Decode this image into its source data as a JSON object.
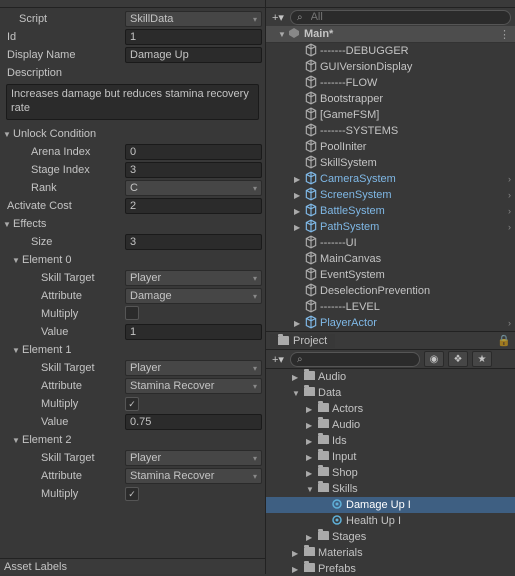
{
  "inspector": {
    "script_label": "Script",
    "script_value": "SkillData",
    "id_label": "Id",
    "id_value": "1",
    "display_name_label": "Display Name",
    "display_name_value": "Damage Up",
    "description_label": "Description",
    "description_value": "Increases damage but reduces stamina recovery rate",
    "unlock_condition": "Unlock Condition",
    "arena_index_label": "Arena Index",
    "arena_index_value": "0",
    "stage_index_label": "Stage Index",
    "stage_index_value": "3",
    "rank_label": "Rank",
    "rank_value": "C",
    "activate_cost_label": "Activate Cost",
    "activate_cost_value": "2",
    "effects": "Effects",
    "size_label": "Size",
    "size_value": "3",
    "el0": "Element 0",
    "el1": "Element 1",
    "el2": "Element 2",
    "skill_target_label": "Skill Target",
    "attribute_label": "Attribute",
    "multiply_label": "Multiply",
    "value_label": "Value",
    "e0_target": "Player",
    "e0_attr": "Damage",
    "e0_value": "1",
    "e1_target": "Player",
    "e1_attr": "Stamina Recover",
    "e1_value": "0.75",
    "e2_target": "Player",
    "e2_attr": "Stamina Recover",
    "asset_labels": "Asset Labels"
  },
  "hierarchy": {
    "search_placeholder": "All",
    "scene": "Main*",
    "items": [
      {
        "name": "-------DEBUGGER",
        "blue": false,
        "d": 1,
        "f": ""
      },
      {
        "name": "GUIVersionDisplay",
        "blue": false,
        "d": 1,
        "f": ""
      },
      {
        "name": "-------FLOW",
        "blue": false,
        "d": 1,
        "f": ""
      },
      {
        "name": "Bootstrapper",
        "blue": false,
        "d": 1,
        "f": ""
      },
      {
        "name": "[GameFSM]",
        "blue": false,
        "d": 1,
        "f": ""
      },
      {
        "name": "-------SYSTEMS",
        "blue": false,
        "d": 1,
        "f": ""
      },
      {
        "name": "PoolIniter",
        "blue": false,
        "d": 1,
        "f": ""
      },
      {
        "name": "SkillSystem",
        "blue": false,
        "d": 1,
        "f": ""
      },
      {
        "name": "CameraSystem",
        "blue": true,
        "d": 1,
        "f": "▶",
        "ch": true
      },
      {
        "name": "ScreenSystem",
        "blue": true,
        "d": 1,
        "f": "▶",
        "ch": true
      },
      {
        "name": "BattleSystem",
        "blue": true,
        "d": 1,
        "f": "▶",
        "ch": true
      },
      {
        "name": "PathSystem",
        "blue": true,
        "d": 1,
        "f": "▶",
        "ch": true
      },
      {
        "name": "-------UI",
        "blue": false,
        "d": 1,
        "f": ""
      },
      {
        "name": "MainCanvas",
        "blue": false,
        "d": 1,
        "f": ""
      },
      {
        "name": "EventSystem",
        "blue": false,
        "d": 1,
        "f": ""
      },
      {
        "name": "DeselectionPrevention",
        "blue": false,
        "d": 1,
        "f": ""
      },
      {
        "name": "-------LEVEL",
        "blue": false,
        "d": 1,
        "f": ""
      },
      {
        "name": "PlayerActor",
        "blue": true,
        "d": 1,
        "f": "▶",
        "ch": true
      }
    ]
  },
  "project": {
    "title": "Project",
    "items": [
      {
        "name": "Audio",
        "d": 2,
        "f": "▶",
        "type": "folder"
      },
      {
        "name": "Data",
        "d": 2,
        "f": "▼",
        "type": "folder"
      },
      {
        "name": "Actors",
        "d": 3,
        "f": "▶",
        "type": "folder"
      },
      {
        "name": "Audio",
        "d": 3,
        "f": "▶",
        "type": "folder"
      },
      {
        "name": "Ids",
        "d": 3,
        "f": "▶",
        "type": "folder"
      },
      {
        "name": "Input",
        "d": 3,
        "f": "▶",
        "type": "folder"
      },
      {
        "name": "Shop",
        "d": 3,
        "f": "▶",
        "type": "folder"
      },
      {
        "name": "Skills",
        "d": 3,
        "f": "▼",
        "type": "folder"
      },
      {
        "name": "Damage Up I",
        "d": 4,
        "f": "",
        "type": "asset",
        "sel": true
      },
      {
        "name": "Health Up I",
        "d": 4,
        "f": "",
        "type": "asset"
      },
      {
        "name": "Stages",
        "d": 3,
        "f": "▶",
        "type": "folder"
      },
      {
        "name": "Materials",
        "d": 2,
        "f": "▶",
        "type": "folder"
      },
      {
        "name": "Prefabs",
        "d": 2,
        "f": "▶",
        "type": "folder"
      }
    ]
  }
}
